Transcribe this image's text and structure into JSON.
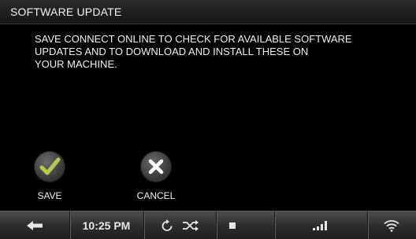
{
  "title_bar": {
    "title": "SOFTWARE UPDATE"
  },
  "message": "SAVE CONNECT ONLINE TO CHECK FOR AVAILABLE SOFTWARE\nUPDATES AND TO DOWNLOAD AND INSTALL THESE ON\nYOUR MACHINE.",
  "actions": {
    "save_label": "SAVE",
    "cancel_label": "CANCEL"
  },
  "status_bar": {
    "time": "10:25 PM",
    "icons": [
      "back-arrow-icon",
      "repeat-icon",
      "shuffle-icon",
      "stop-icon",
      "signal-bars-icon",
      "wifi-icon"
    ]
  },
  "colors": {
    "check_accent": "#b5c94a",
    "background": "#000000",
    "bar_gradient_top": "#4d4d4d"
  }
}
